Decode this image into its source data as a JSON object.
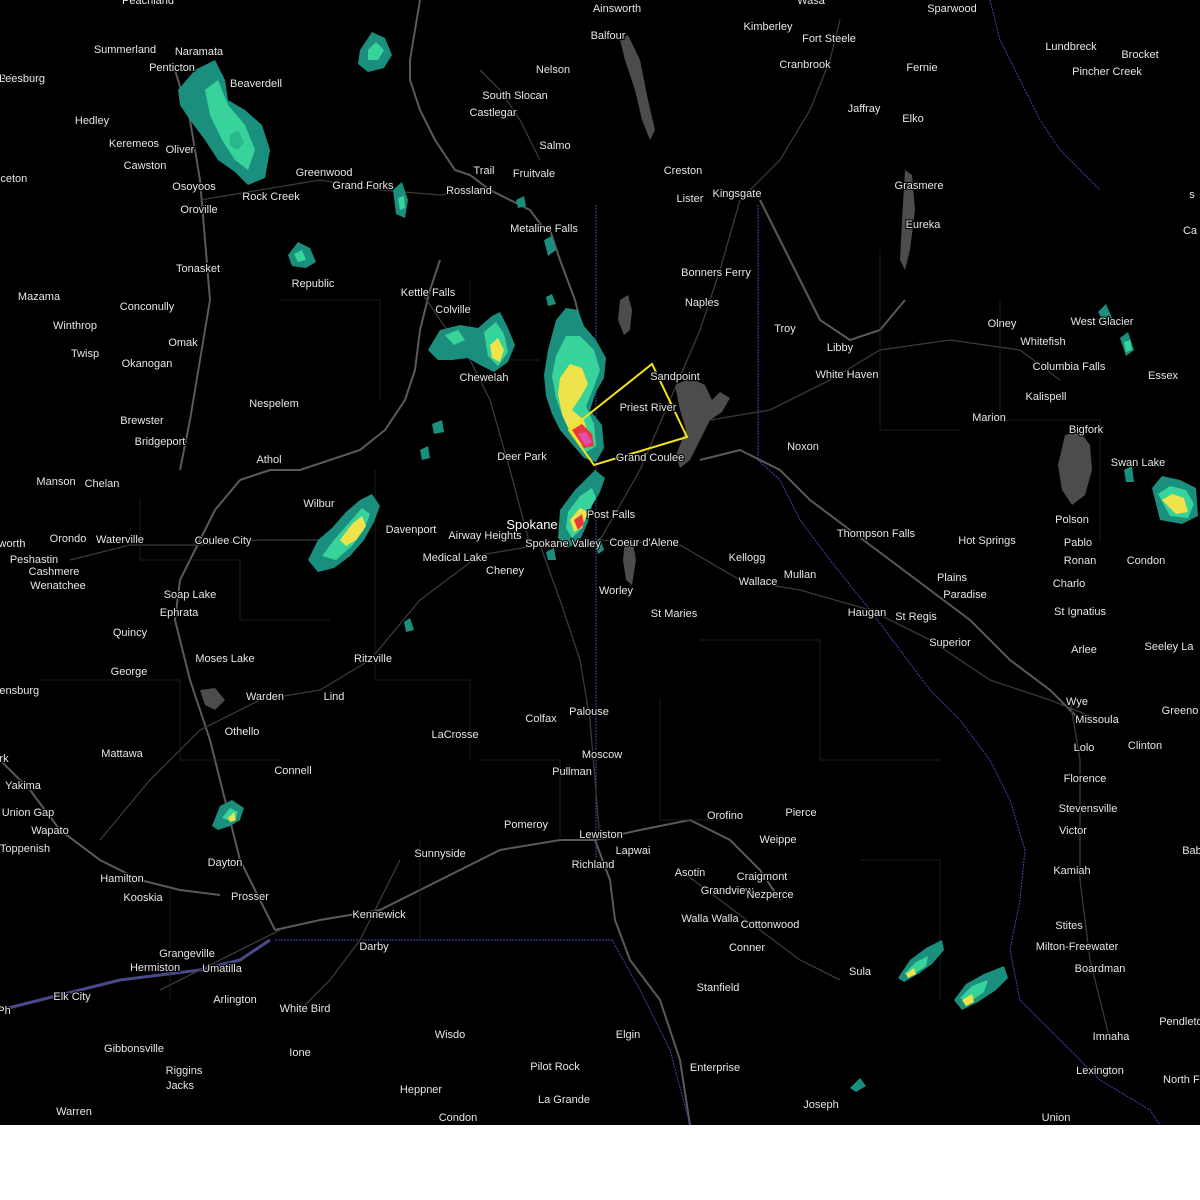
{
  "map": {
    "warning_color": "#f5e21a",
    "radar_colors": {
      "light": "#1a8f7e",
      "moderate": "#38d39a",
      "heavy": "#f0e24a",
      "intense": "#e83a3a",
      "extreme": "#e14fb2"
    },
    "cities": [
      {
        "name": "Peachland",
        "big": false
      },
      {
        "name": "Ainsworth",
        "big": false
      },
      {
        "name": "Wasa",
        "big": false
      },
      {
        "name": "Sparwood",
        "big": false
      },
      {
        "name": "Summerland",
        "big": false
      },
      {
        "name": "Naramata",
        "big": false
      },
      {
        "name": "Kimberley",
        "big": false
      },
      {
        "name": "Balfour",
        "big": false
      },
      {
        "name": "Fort Steele",
        "big": false
      },
      {
        "name": "Lundbreck",
        "big": false
      },
      {
        "name": "Brocket",
        "big": false
      },
      {
        "name": "Penticton",
        "big": false
      },
      {
        "name": "Nelson",
        "big": false
      },
      {
        "name": "Cranbrook",
        "big": false
      },
      {
        "name": "Fernie",
        "big": false
      },
      {
        "name": "Pincher Creek",
        "big": false
      },
      {
        "name": "Princeton",
        "big": false
      },
      {
        "name": "Beaverdell",
        "big": false
      },
      {
        "name": "South Slocan",
        "big": false
      },
      {
        "name": "Jaffray",
        "big": false
      },
      {
        "name": "Hedley",
        "big": false
      },
      {
        "name": "Castlegar",
        "big": false
      },
      {
        "name": "Elko",
        "big": false
      },
      {
        "name": "Keremeos",
        "big": false
      },
      {
        "name": "Oliver",
        "big": false
      },
      {
        "name": "Salmo",
        "big": false
      },
      {
        "name": "Cawston",
        "big": false
      },
      {
        "name": "Trail",
        "big": false
      },
      {
        "name": "Creston",
        "big": false
      },
      {
        "name": "Greenwood",
        "big": false
      },
      {
        "name": "Fruitvale",
        "big": false
      },
      {
        "name": "Osoyoos",
        "big": false
      },
      {
        "name": "Grand Forks",
        "big": false
      },
      {
        "name": "Rossland",
        "big": false
      },
      {
        "name": "Grasmere",
        "big": false
      },
      {
        "name": "Rock Creek",
        "big": false
      },
      {
        "name": "Lister",
        "big": false
      },
      {
        "name": "Kingsgate",
        "big": false
      },
      {
        "name": "Oroville",
        "big": false
      },
      {
        "name": "Eureka",
        "big": false
      },
      {
        "name": "Metaline Falls",
        "big": false
      },
      {
        "name": "Tonasket",
        "big": false
      },
      {
        "name": "Bonners Ferry",
        "big": false
      },
      {
        "name": "Republic",
        "big": false
      },
      {
        "name": "Kettle Falls",
        "big": false
      },
      {
        "name": "Mazama",
        "big": false
      },
      {
        "name": "Naples",
        "big": false
      },
      {
        "name": "Conconully",
        "big": false
      },
      {
        "name": "Colville",
        "big": false
      },
      {
        "name": "Olney",
        "big": false
      },
      {
        "name": "West Glacier",
        "big": false
      },
      {
        "name": "Winthrop",
        "big": false
      },
      {
        "name": "Troy",
        "big": false
      },
      {
        "name": "Omak",
        "big": false
      },
      {
        "name": "Whitefish",
        "big": false
      },
      {
        "name": "Libby",
        "big": false
      },
      {
        "name": "Twisp",
        "big": false
      },
      {
        "name": "Okanogan",
        "big": false
      },
      {
        "name": "Chewelah",
        "big": false
      },
      {
        "name": "Sandpoint",
        "big": false
      },
      {
        "name": "Columbia Falls",
        "big": false
      },
      {
        "name": "White Haven",
        "big": false
      },
      {
        "name": "Essex",
        "big": false
      },
      {
        "name": "Nespelem",
        "big": false
      },
      {
        "name": "Kalispell",
        "big": false
      },
      {
        "name": "Priest River",
        "big": false
      },
      {
        "name": "Brewster",
        "big": false
      },
      {
        "name": "Marion",
        "big": false
      },
      {
        "name": "Bigfork",
        "big": false
      },
      {
        "name": "Bridgeport",
        "big": false
      },
      {
        "name": "Noxon",
        "big": false
      },
      {
        "name": "Deer Park",
        "big": false
      },
      {
        "name": "Grand Coulee",
        "big": false
      },
      {
        "name": "Athol",
        "big": false
      },
      {
        "name": "Swan Lake",
        "big": false
      },
      {
        "name": "Manson",
        "big": false
      },
      {
        "name": "Chelan",
        "big": false
      },
      {
        "name": "Wilbur",
        "big": false
      },
      {
        "name": "Polson",
        "big": false
      },
      {
        "name": "Post Falls",
        "big": false
      },
      {
        "name": "Spokane",
        "big": true
      },
      {
        "name": "Davenport",
        "big": false
      },
      {
        "name": "Airway Heights",
        "big": false
      },
      {
        "name": "Thompson Falls",
        "big": false
      },
      {
        "name": "Orondo",
        "big": false
      },
      {
        "name": "Waterville",
        "big": false
      },
      {
        "name": "Coulee City",
        "big": false
      },
      {
        "name": "Coeur d'Alene",
        "big": false
      },
      {
        "name": "Hot Springs",
        "big": false
      },
      {
        "name": "Pablo",
        "big": false
      },
      {
        "name": "Spokane Valley",
        "big": false
      },
      {
        "name": "worth",
        "big": false
      },
      {
        "name": "Medical Lake",
        "big": false
      },
      {
        "name": "Condon",
        "big": false
      },
      {
        "name": "Peshastin",
        "big": false
      },
      {
        "name": "Ronan",
        "big": false
      },
      {
        "name": "Cashmere",
        "big": false
      },
      {
        "name": "Cheney",
        "big": false
      },
      {
        "name": "Kellogg",
        "big": false
      },
      {
        "name": "Mullan",
        "big": false
      },
      {
        "name": "Plains",
        "big": false
      },
      {
        "name": "Wenatchee",
        "big": false
      },
      {
        "name": "Wallace",
        "big": false
      },
      {
        "name": "Charlo",
        "big": false
      },
      {
        "name": "Soap Lake",
        "big": false
      },
      {
        "name": "Ephrata",
        "big": false
      },
      {
        "name": "Paradise",
        "big": false
      },
      {
        "name": "St Ignatius",
        "big": false
      },
      {
        "name": "Worley",
        "big": false
      },
      {
        "name": "St Maries",
        "big": false
      },
      {
        "name": "Haugan",
        "big": false
      },
      {
        "name": "St Regis",
        "big": false
      },
      {
        "name": "Quincy",
        "big": false
      },
      {
        "name": "Superior",
        "big": false
      },
      {
        "name": "Seeley La",
        "big": false
      },
      {
        "name": "Arlee",
        "big": false
      },
      {
        "name": "Moses Lake",
        "big": false
      },
      {
        "name": "Ritzville",
        "big": false
      },
      {
        "name": "George",
        "big": false
      },
      {
        "name": "lensburg",
        "big": false
      },
      {
        "name": "Lind",
        "big": false
      },
      {
        "name": "Warden",
        "big": false
      },
      {
        "name": "Wye",
        "big": false
      },
      {
        "name": "Colfax",
        "big": false
      },
      {
        "name": "Missoula",
        "big": false
      },
      {
        "name": "Greeno",
        "big": false
      },
      {
        "name": "Palouse",
        "big": false
      },
      {
        "name": "Othello",
        "big": false
      },
      {
        "name": "LaCrosse",
        "big": false
      },
      {
        "name": "Lolo",
        "big": false
      },
      {
        "name": "Clinton",
        "big": false
      },
      {
        "name": "Mattawa",
        "big": false
      },
      {
        "name": "Moscow",
        "big": false
      },
      {
        "name": "Pullman",
        "big": false
      },
      {
        "name": "Connell",
        "big": false
      },
      {
        "name": "Florence",
        "big": false
      },
      {
        "name": "Yakima",
        "big": false
      },
      {
        "name": "Union Gap",
        "big": false
      },
      {
        "name": "Stevensville",
        "big": false
      },
      {
        "name": "Orofino",
        "big": false
      },
      {
        "name": "Pierce",
        "big": false
      },
      {
        "name": "Wapato",
        "big": false
      },
      {
        "name": "Pomeroy",
        "big": false
      },
      {
        "name": "Victor",
        "big": false
      },
      {
        "name": "Lewiston",
        "big": false
      },
      {
        "name": "Weippe",
        "big": false
      },
      {
        "name": "Toppenish",
        "big": false
      },
      {
        "name": "Lapwai",
        "big": false
      },
      {
        "name": "Sunnyside",
        "big": false
      },
      {
        "name": "Dayton",
        "big": false
      },
      {
        "name": "Richland",
        "big": false
      },
      {
        "name": "Asotin",
        "big": false
      },
      {
        "name": "Craigmont",
        "big": false
      },
      {
        "name": "Kamiah",
        "big": false
      },
      {
        "name": "Hamilton",
        "big": false
      },
      {
        "name": "Grandview",
        "big": false
      },
      {
        "name": "Nezperce",
        "big": false
      },
      {
        "name": "Kooskia",
        "big": false
      },
      {
        "name": "Prosser",
        "big": false
      },
      {
        "name": "Kennewick",
        "big": false
      },
      {
        "name": "Walla Walla",
        "big": false
      },
      {
        "name": "Cottonwood",
        "big": false
      },
      {
        "name": "Stites",
        "big": false
      },
      {
        "name": "Darby",
        "big": false
      },
      {
        "name": "Milton-Freewater",
        "big": false
      },
      {
        "name": "Conner",
        "big": false
      },
      {
        "name": "Grangeville",
        "big": false
      },
      {
        "name": "Umatilla",
        "big": false
      },
      {
        "name": "Hermiston",
        "big": false
      },
      {
        "name": "Boardman",
        "big": false
      },
      {
        "name": "Sula",
        "big": false
      },
      {
        "name": "Elk City",
        "big": false
      },
      {
        "name": "Arlington",
        "big": false
      },
      {
        "name": "Stanfield",
        "big": false
      },
      {
        "name": "White Bird",
        "big": false
      },
      {
        "name": "Pendleton",
        "big": false
      },
      {
        "name": "Wisdo",
        "big": false
      },
      {
        "name": "Elgin",
        "big": false
      },
      {
        "name": "Imnaha",
        "big": false
      },
      {
        "name": "Gibbonsville",
        "big": false
      },
      {
        "name": "Ione",
        "big": false
      },
      {
        "name": "Pilot Rock",
        "big": false
      },
      {
        "name": "Enterprise",
        "big": false
      },
      {
        "name": "Riggins",
        "big": false
      },
      {
        "name": "Lexington",
        "big": false
      },
      {
        "name": "North Fork",
        "big": false
      },
      {
        "name": "Jacks",
        "big": false
      },
      {
        "name": "Heppner",
        "big": false
      },
      {
        "name": "La Grande",
        "big": false
      },
      {
        "name": "Joseph",
        "big": false
      },
      {
        "name": "Warren",
        "big": false
      },
      {
        "name": "Condon",
        "big": false
      },
      {
        "name": "Union",
        "big": false
      },
      {
        "name": "Leesburg",
        "big": false
      },
      {
        "name": "Princeton",
        "big": false
      },
      {
        "name": "rk",
        "big": false
      },
      {
        "name": "s",
        "big": false
      },
      {
        "name": "Ca",
        "big": false
      },
      {
        "name": "Bab",
        "big": false
      },
      {
        "name": "Ph",
        "big": false
      },
      {
        "name": "o",
        "big": false
      }
    ]
  }
}
